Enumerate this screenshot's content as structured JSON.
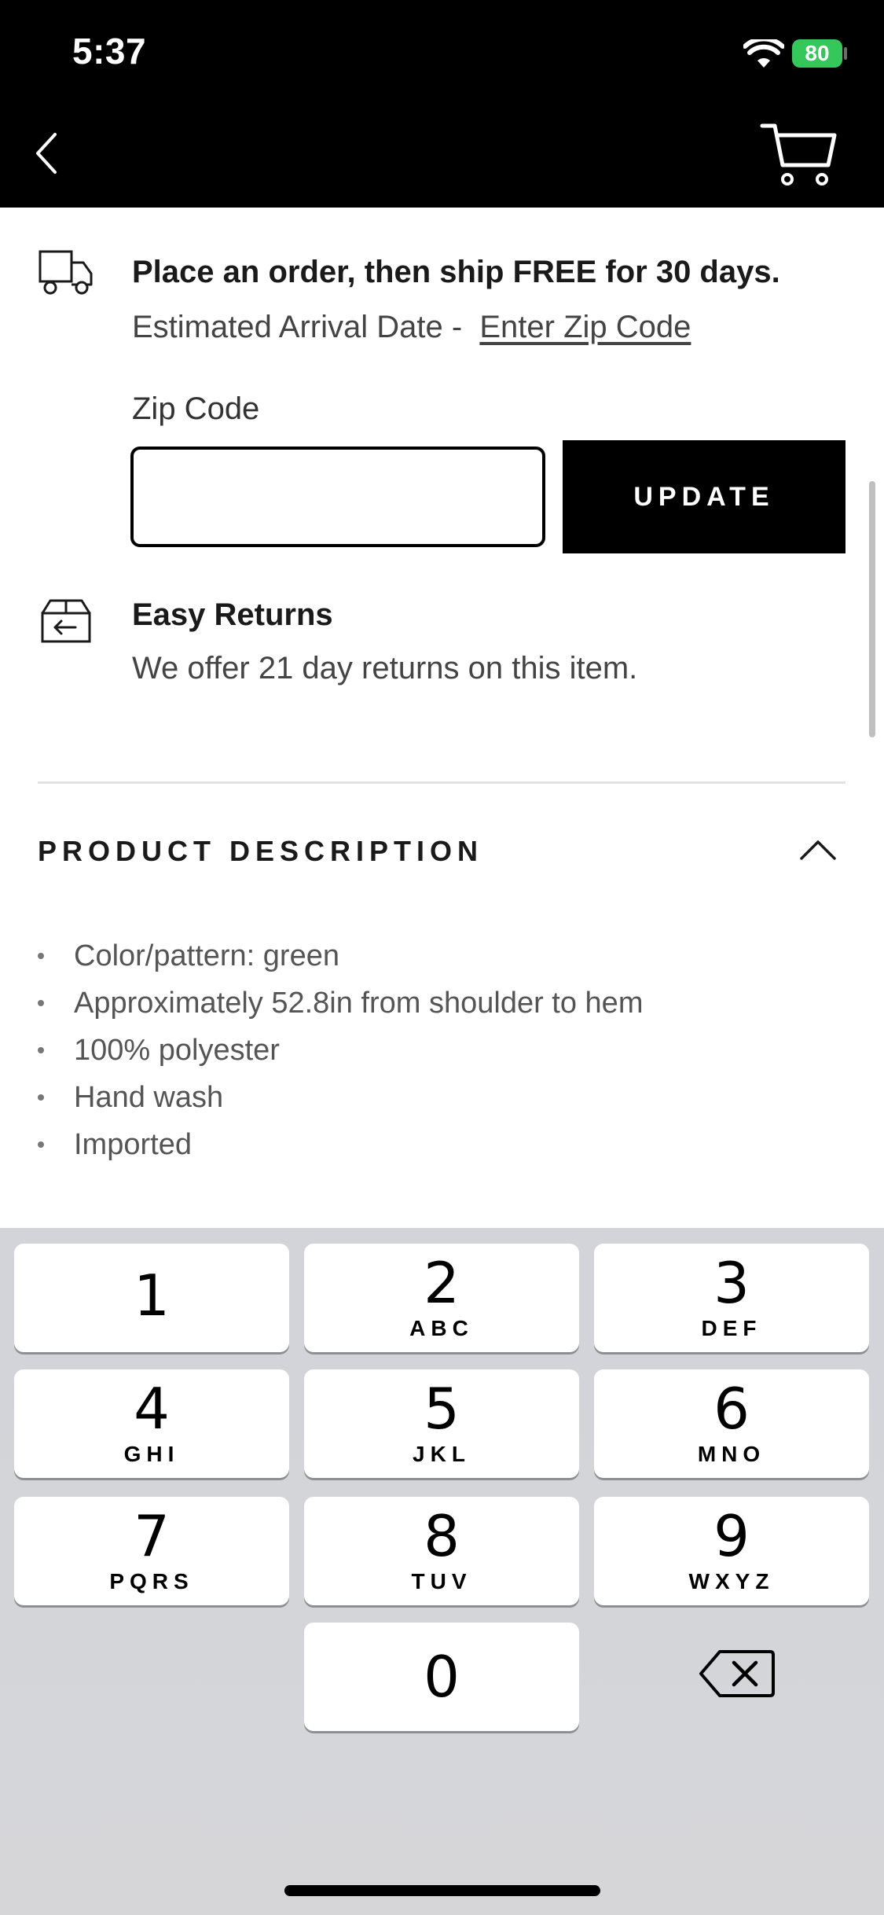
{
  "status_bar": {
    "time": "5:37",
    "battery": "80"
  },
  "shipping": {
    "headline": "Place an order, then ship FREE for 30 days.",
    "eta_label": "Estimated Arrival Date -",
    "eta_link": "Enter Zip Code",
    "zip_label": "Zip Code",
    "zip_value": "",
    "update_button": "UPDATE"
  },
  "returns": {
    "title": "Easy Returns",
    "text": "We offer 21 day returns on this item."
  },
  "product_description": {
    "title": "PRODUCT DESCRIPTION",
    "items": [
      "Color/pattern: green",
      "Approximately 52.8in from shoulder to hem",
      "100% polyester",
      "Hand wash",
      "Imported"
    ]
  },
  "keypad": {
    "keys": [
      {
        "num": "1",
        "letters": ""
      },
      {
        "num": "2",
        "letters": "ABC"
      },
      {
        "num": "3",
        "letters": "DEF"
      },
      {
        "num": "4",
        "letters": "GHI"
      },
      {
        "num": "5",
        "letters": "JKL"
      },
      {
        "num": "6",
        "letters": "MNO"
      },
      {
        "num": "7",
        "letters": "PQRS"
      },
      {
        "num": "8",
        "letters": "TUV"
      },
      {
        "num": "9",
        "letters": "WXYZ"
      },
      {
        "num": "0",
        "letters": ""
      }
    ]
  }
}
